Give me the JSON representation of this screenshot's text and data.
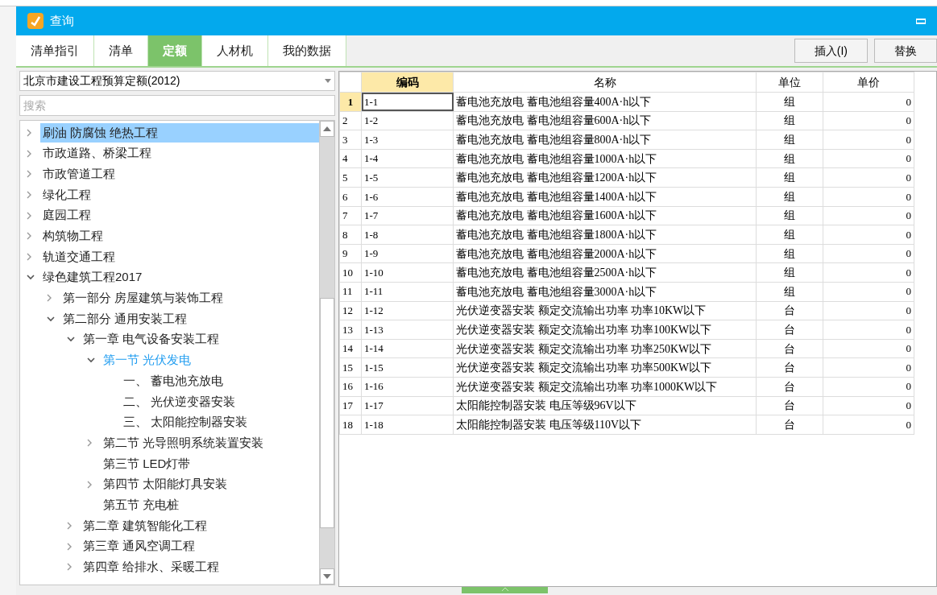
{
  "window": {
    "title": "查询"
  },
  "tabs": [
    {
      "label": "清单指引",
      "selected": false
    },
    {
      "label": "清单",
      "selected": false
    },
    {
      "label": "定额",
      "selected": true
    },
    {
      "label": "人材机",
      "selected": false
    },
    {
      "label": "我的数据",
      "selected": false
    }
  ],
  "toolbar_buttons": [
    "插入(I)",
    "替换"
  ],
  "library_select": {
    "value": "北京市建设工程预算定额(2012)"
  },
  "search": {
    "placeholder": "搜索"
  },
  "tree": [
    {
      "label": "刷油 防腐蚀 绝热工程",
      "expanded": false,
      "selected": true,
      "active": false
    },
    {
      "label": "市政道路、桥梁工程",
      "expanded": false,
      "selected": false,
      "active": false
    },
    {
      "label": "市政管道工程",
      "expanded": false,
      "selected": false,
      "active": false
    },
    {
      "label": "绿化工程",
      "expanded": false,
      "selected": false,
      "active": false
    },
    {
      "label": "庭园工程",
      "expanded": false,
      "selected": false,
      "active": false
    },
    {
      "label": "构筑物工程",
      "expanded": false,
      "selected": false,
      "active": false
    },
    {
      "label": "轨道交通工程",
      "expanded": false,
      "selected": false,
      "active": false
    },
    {
      "label": "绿色建筑工程2017",
      "expanded": true,
      "selected": false,
      "active": false,
      "children": [
        {
          "label": "第一部分 房屋建筑与装饰工程",
          "expanded": false,
          "selected": false,
          "active": false
        },
        {
          "label": "第二部分 通用安装工程",
          "expanded": true,
          "selected": false,
          "active": false,
          "children": [
            {
              "label": "第一章 电气设备安装工程",
              "expanded": true,
              "selected": false,
              "active": false,
              "children": [
                {
                  "label": "第一节 光伏发电",
                  "expanded": true,
                  "selected": false,
                  "active": true,
                  "children": [
                    {
                      "label": "一、 蓄电池充放电",
                      "selected": false,
                      "active": false
                    },
                    {
                      "label": "二、 光伏逆变器安装",
                      "selected": false,
                      "active": false
                    },
                    {
                      "label": "三、 太阳能控制器安装",
                      "selected": false,
                      "active": false
                    }
                  ]
                },
                {
                  "label": "第二节 光导照明系统装置安装",
                  "expanded": false,
                  "selected": false,
                  "active": false
                },
                {
                  "label": "第三节 LED灯带",
                  "selected": false,
                  "active": false
                },
                {
                  "label": "第四节 太阳能灯具安装",
                  "expanded": false,
                  "selected": false,
                  "active": false
                },
                {
                  "label": "第五节 充电桩",
                  "selected": false,
                  "active": false
                }
              ]
            },
            {
              "label": "第二章 建筑智能化工程",
              "expanded": false,
              "selected": false,
              "active": false
            },
            {
              "label": "第三章 通风空调工程",
              "expanded": false,
              "selected": false,
              "active": false
            },
            {
              "label": "第四章 给排水、采暖工程",
              "expanded": false,
              "selected": false,
              "active": false
            }
          ]
        }
      ]
    }
  ],
  "table": {
    "columns": [
      "编码",
      "名称",
      "单位",
      "单价"
    ],
    "rows": [
      {
        "index": "1",
        "code": "1-1",
        "name": "蓄电池充放电 蓄电池组容量400A·h以下",
        "unit": "组",
        "price": "0",
        "selected": true
      },
      {
        "index": "2",
        "code": "1-2",
        "name": "蓄电池充放电 蓄电池组容量600A·h以下",
        "unit": "组",
        "price": "0",
        "selected": false
      },
      {
        "index": "3",
        "code": "1-3",
        "name": "蓄电池充放电 蓄电池组容量800A·h以下",
        "unit": "组",
        "price": "0",
        "selected": false
      },
      {
        "index": "4",
        "code": "1-4",
        "name": "蓄电池充放电 蓄电池组容量1000A·h以下",
        "unit": "组",
        "price": "0",
        "selected": false
      },
      {
        "index": "5",
        "code": "1-5",
        "name": "蓄电池充放电 蓄电池组容量1200A·h以下",
        "unit": "组",
        "price": "0",
        "selected": false
      },
      {
        "index": "6",
        "code": "1-6",
        "name": "蓄电池充放电 蓄电池组容量1400A·h以下",
        "unit": "组",
        "price": "0",
        "selected": false
      },
      {
        "index": "7",
        "code": "1-7",
        "name": "蓄电池充放电 蓄电池组容量1600A·h以下",
        "unit": "组",
        "price": "0",
        "selected": false
      },
      {
        "index": "8",
        "code": "1-8",
        "name": "蓄电池充放电 蓄电池组容量1800A·h以下",
        "unit": "组",
        "price": "0",
        "selected": false
      },
      {
        "index": "9",
        "code": "1-9",
        "name": "蓄电池充放电 蓄电池组容量2000A·h以下",
        "unit": "组",
        "price": "0",
        "selected": false
      },
      {
        "index": "10",
        "code": "1-10",
        "name": "蓄电池充放电 蓄电池组容量2500A·h以下",
        "unit": "组",
        "price": "0",
        "selected": false
      },
      {
        "index": "11",
        "code": "1-11",
        "name": "蓄电池充放电 蓄电池组容量3000A·h以下",
        "unit": "组",
        "price": "0",
        "selected": false
      },
      {
        "index": "12",
        "code": "1-12",
        "name": "光伏逆变器安装 额定交流输出功率 功率10KW以下",
        "unit": "台",
        "price": "0",
        "selected": false
      },
      {
        "index": "13",
        "code": "1-13",
        "name": "光伏逆变器安装 额定交流输出功率 功率100KW以下",
        "unit": "台",
        "price": "0",
        "selected": false
      },
      {
        "index": "14",
        "code": "1-14",
        "name": "光伏逆变器安装 额定交流输出功率 功率250KW以下",
        "unit": "台",
        "price": "0",
        "selected": false
      },
      {
        "index": "15",
        "code": "1-15",
        "name": "光伏逆变器安装 额定交流输出功率 功率500KW以下",
        "unit": "台",
        "price": "0",
        "selected": false
      },
      {
        "index": "16",
        "code": "1-16",
        "name": "光伏逆变器安装 额定交流输出功率 功率1000KW以下",
        "unit": "台",
        "price": "0",
        "selected": false
      },
      {
        "index": "17",
        "code": "1-17",
        "name": "太阳能控制器安装 电压等级96V以下",
        "unit": "台",
        "price": "0",
        "selected": false
      },
      {
        "index": "18",
        "code": "1-18",
        "name": "太阳能控制器安装 电压等级110V以下",
        "unit": "台",
        "price": "0",
        "selected": false
      }
    ]
  }
}
